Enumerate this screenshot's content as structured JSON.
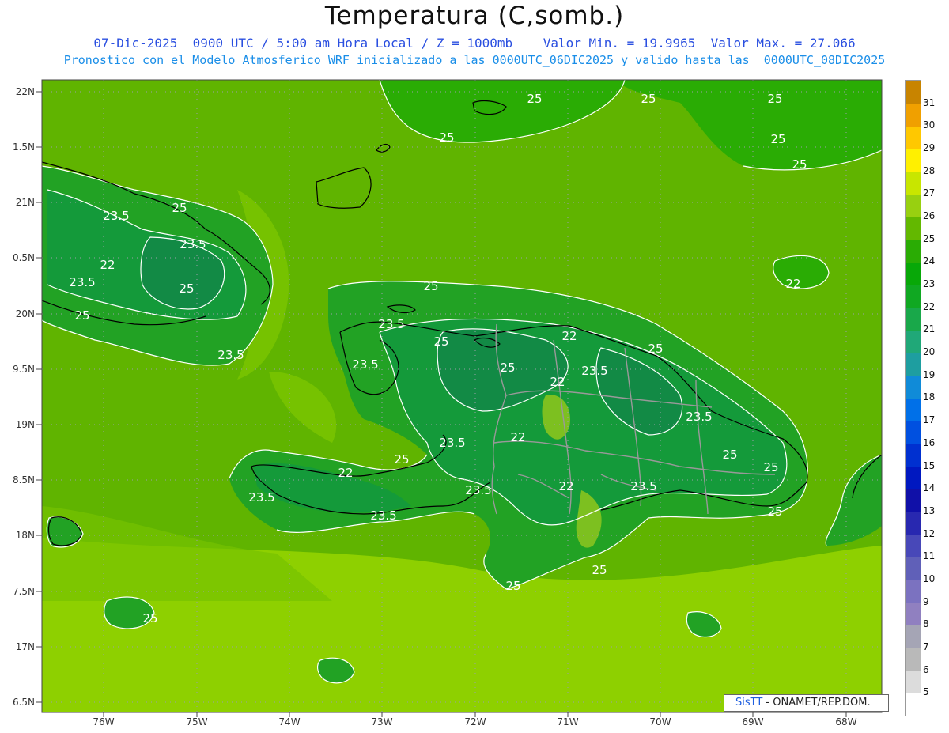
{
  "title": "Temperatura (C,somb.)",
  "subtitle1": "07-Dic-2025  0900 UTC / 5:00 am Hora Local / Z = 1000mb    Valor Min. = 19.9965  Valor Max. = 27.066",
  "subtitle2": "Pronostico con el Modelo Atmosferico WRF inicializado a las 0000UTC_06DIC2025 y valido hasta las  0000UTC_08DIC2025",
  "lat_labels": [
    "22N",
    "1.5N",
    "21N",
    "0.5N",
    "20N",
    "9.5N",
    "19N",
    "8.5N",
    "18N",
    "7.5N",
    "17N",
    "6.5N"
  ],
  "lon_labels": [
    "76W",
    "75W",
    "74W",
    "73W",
    "72W",
    "71W",
    "70W",
    "69W",
    "68W"
  ],
  "contour_labels": [
    "25",
    "25",
    "25",
    "25",
    "25",
    "25",
    "23.5",
    "25",
    "23.5",
    "22",
    "23.5",
    "25",
    "25",
    "23.5",
    "22",
    "25",
    "23.5",
    "23.5",
    "25",
    "25",
    "22",
    "22",
    "23.5",
    "25",
    "23.5",
    "25",
    "25",
    "25",
    "22",
    "23.5",
    "22",
    "23.5",
    "25",
    "23.5",
    "23.5",
    "22",
    "23.5",
    "25",
    "25",
    "25",
    "25",
    "25",
    "25"
  ],
  "colorbar": {
    "levels": [
      "5",
      "6",
      "7",
      "8",
      "9",
      "10",
      "11",
      "12",
      "13",
      "14",
      "15",
      "16",
      "17",
      "18",
      "19",
      "20",
      "21",
      "22",
      "23",
      "24",
      "25",
      "26",
      "27",
      "28",
      "29",
      "30",
      "31"
    ],
    "colors": [
      "#ffffff",
      "#dcdcdc",
      "#b9b9b9",
      "#a5a5b5",
      "#9080c0",
      "#7b72c0",
      "#6060b8",
      "#4848b8",
      "#2828b0",
      "#1010a8",
      "#0018c0",
      "#0030d0",
      "#0050e0",
      "#0070e8",
      "#108bd8",
      "#1e9ea0",
      "#20a878",
      "#19a84a",
      "#10a822",
      "#08a808",
      "#2aac04",
      "#63b800",
      "#98d010",
      "#c8e600",
      "#fff000",
      "#ffc800",
      "#f0a000",
      "#c88400"
    ]
  },
  "credit": {
    "sis": "SisTT",
    "rest": " - ONAMET/REP.DOM."
  },
  "colors": {
    "land_cool": "#149a3a",
    "land_warm": "#22a224",
    "sea_25": "#60b400",
    "sea_26": "#8ed000",
    "contour": "#ffffff",
    "coast": "#000000",
    "border": "#999999"
  }
}
